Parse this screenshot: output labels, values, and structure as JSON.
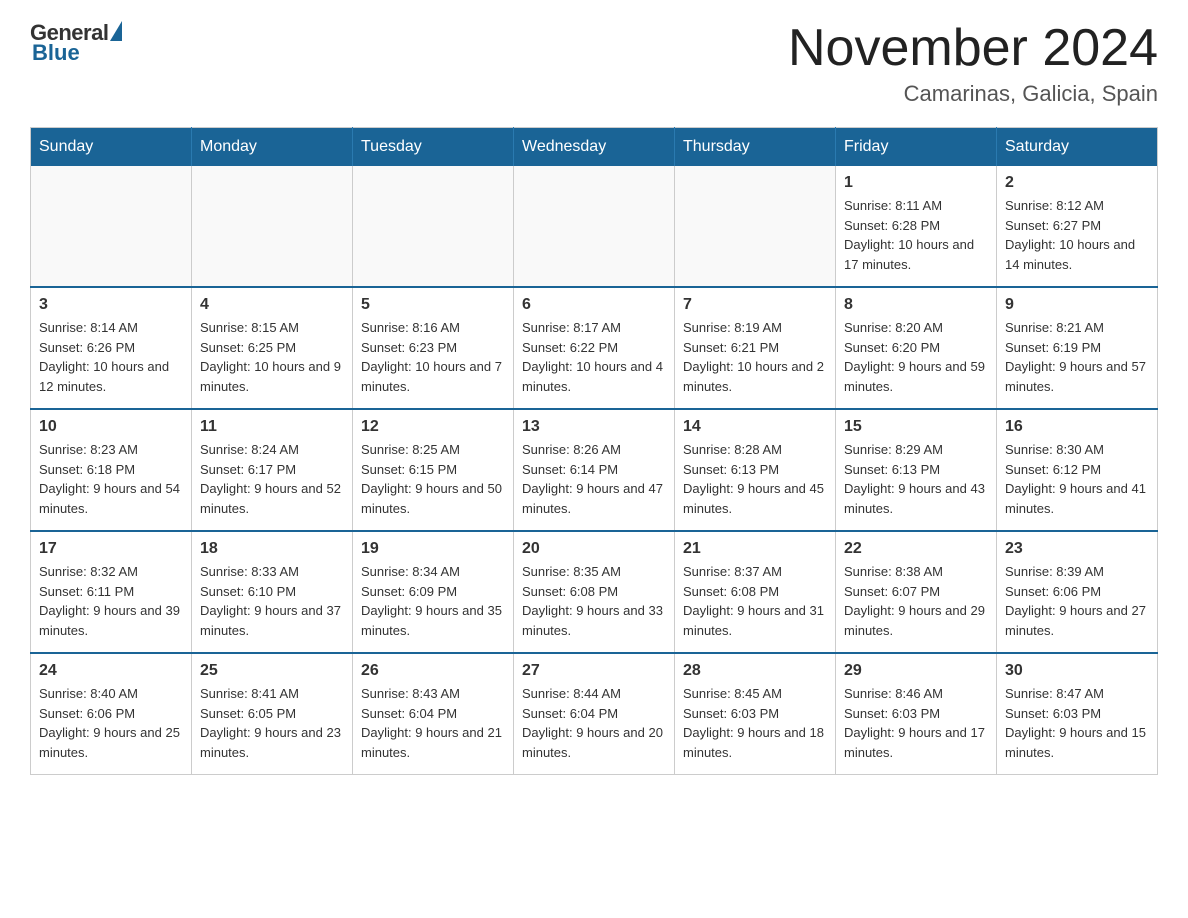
{
  "header": {
    "logo": {
      "general": "General",
      "blue": "Blue"
    },
    "title": "November 2024",
    "location": "Camarinas, Galicia, Spain"
  },
  "weekdays": [
    "Sunday",
    "Monday",
    "Tuesday",
    "Wednesday",
    "Thursday",
    "Friday",
    "Saturday"
  ],
  "weeks": [
    [
      {
        "day": "",
        "info": ""
      },
      {
        "day": "",
        "info": ""
      },
      {
        "day": "",
        "info": ""
      },
      {
        "day": "",
        "info": ""
      },
      {
        "day": "",
        "info": ""
      },
      {
        "day": "1",
        "info": "Sunrise: 8:11 AM\nSunset: 6:28 PM\nDaylight: 10 hours and 17 minutes."
      },
      {
        "day": "2",
        "info": "Sunrise: 8:12 AM\nSunset: 6:27 PM\nDaylight: 10 hours and 14 minutes."
      }
    ],
    [
      {
        "day": "3",
        "info": "Sunrise: 8:14 AM\nSunset: 6:26 PM\nDaylight: 10 hours and 12 minutes."
      },
      {
        "day": "4",
        "info": "Sunrise: 8:15 AM\nSunset: 6:25 PM\nDaylight: 10 hours and 9 minutes."
      },
      {
        "day": "5",
        "info": "Sunrise: 8:16 AM\nSunset: 6:23 PM\nDaylight: 10 hours and 7 minutes."
      },
      {
        "day": "6",
        "info": "Sunrise: 8:17 AM\nSunset: 6:22 PM\nDaylight: 10 hours and 4 minutes."
      },
      {
        "day": "7",
        "info": "Sunrise: 8:19 AM\nSunset: 6:21 PM\nDaylight: 10 hours and 2 minutes."
      },
      {
        "day": "8",
        "info": "Sunrise: 8:20 AM\nSunset: 6:20 PM\nDaylight: 9 hours and 59 minutes."
      },
      {
        "day": "9",
        "info": "Sunrise: 8:21 AM\nSunset: 6:19 PM\nDaylight: 9 hours and 57 minutes."
      }
    ],
    [
      {
        "day": "10",
        "info": "Sunrise: 8:23 AM\nSunset: 6:18 PM\nDaylight: 9 hours and 54 minutes."
      },
      {
        "day": "11",
        "info": "Sunrise: 8:24 AM\nSunset: 6:17 PM\nDaylight: 9 hours and 52 minutes."
      },
      {
        "day": "12",
        "info": "Sunrise: 8:25 AM\nSunset: 6:15 PM\nDaylight: 9 hours and 50 minutes."
      },
      {
        "day": "13",
        "info": "Sunrise: 8:26 AM\nSunset: 6:14 PM\nDaylight: 9 hours and 47 minutes."
      },
      {
        "day": "14",
        "info": "Sunrise: 8:28 AM\nSunset: 6:13 PM\nDaylight: 9 hours and 45 minutes."
      },
      {
        "day": "15",
        "info": "Sunrise: 8:29 AM\nSunset: 6:13 PM\nDaylight: 9 hours and 43 minutes."
      },
      {
        "day": "16",
        "info": "Sunrise: 8:30 AM\nSunset: 6:12 PM\nDaylight: 9 hours and 41 minutes."
      }
    ],
    [
      {
        "day": "17",
        "info": "Sunrise: 8:32 AM\nSunset: 6:11 PM\nDaylight: 9 hours and 39 minutes."
      },
      {
        "day": "18",
        "info": "Sunrise: 8:33 AM\nSunset: 6:10 PM\nDaylight: 9 hours and 37 minutes."
      },
      {
        "day": "19",
        "info": "Sunrise: 8:34 AM\nSunset: 6:09 PM\nDaylight: 9 hours and 35 minutes."
      },
      {
        "day": "20",
        "info": "Sunrise: 8:35 AM\nSunset: 6:08 PM\nDaylight: 9 hours and 33 minutes."
      },
      {
        "day": "21",
        "info": "Sunrise: 8:37 AM\nSunset: 6:08 PM\nDaylight: 9 hours and 31 minutes."
      },
      {
        "day": "22",
        "info": "Sunrise: 8:38 AM\nSunset: 6:07 PM\nDaylight: 9 hours and 29 minutes."
      },
      {
        "day": "23",
        "info": "Sunrise: 8:39 AM\nSunset: 6:06 PM\nDaylight: 9 hours and 27 minutes."
      }
    ],
    [
      {
        "day": "24",
        "info": "Sunrise: 8:40 AM\nSunset: 6:06 PM\nDaylight: 9 hours and 25 minutes."
      },
      {
        "day": "25",
        "info": "Sunrise: 8:41 AM\nSunset: 6:05 PM\nDaylight: 9 hours and 23 minutes."
      },
      {
        "day": "26",
        "info": "Sunrise: 8:43 AM\nSunset: 6:04 PM\nDaylight: 9 hours and 21 minutes."
      },
      {
        "day": "27",
        "info": "Sunrise: 8:44 AM\nSunset: 6:04 PM\nDaylight: 9 hours and 20 minutes."
      },
      {
        "day": "28",
        "info": "Sunrise: 8:45 AM\nSunset: 6:03 PM\nDaylight: 9 hours and 18 minutes."
      },
      {
        "day": "29",
        "info": "Sunrise: 8:46 AM\nSunset: 6:03 PM\nDaylight: 9 hours and 17 minutes."
      },
      {
        "day": "30",
        "info": "Sunrise: 8:47 AM\nSunset: 6:03 PM\nDaylight: 9 hours and 15 minutes."
      }
    ]
  ]
}
